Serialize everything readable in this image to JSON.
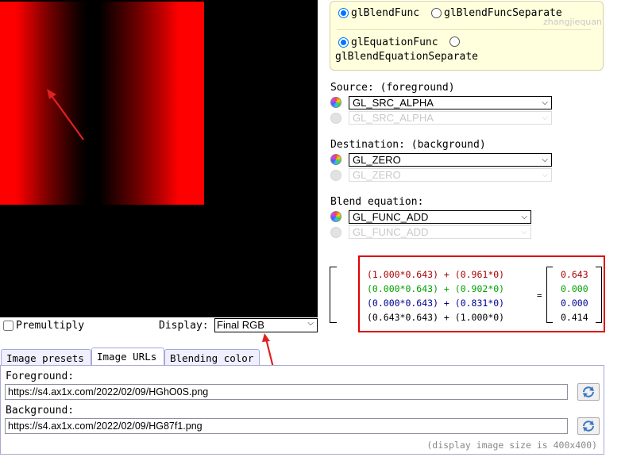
{
  "display": {
    "premultiply_label": "Premultiply",
    "premultiply_checked": false,
    "display_label": "Display:",
    "display_value": "Final RGB"
  },
  "tabs": [
    "Image presets",
    "Image URLs",
    "Blending color"
  ],
  "active_tab": "Image URLs",
  "urls": {
    "foreground_label": "Foreground:",
    "foreground_value": "https://s4.ax1x.com/2022/02/09/HGhO0S.png",
    "background_label": "Background:",
    "background_value": "https://s4.ax1x.com/2022/02/09/HG87f1.png",
    "size_note": "(display image size is 400x400)"
  },
  "blend_func": {
    "option1": "glBlendFunc",
    "option2": "glBlendFuncSeparate",
    "option3": "glEquationFunc",
    "option4": "glBlendEquationSeparate",
    "selected_func": "glBlendFunc",
    "selected_equation": "glEquationFunc"
  },
  "watermark": "zhangjiequan",
  "source": {
    "label": "Source: (foreground)",
    "value": "GL_SRC_ALPHA",
    "disabled_value": "GL_SRC_ALPHA"
  },
  "destination": {
    "label": "Destination: (background)",
    "value": "GL_ZERO",
    "disabled_value": "GL_ZERO"
  },
  "equation": {
    "label": "Blend equation:",
    "value": "GL_FUNC_ADD",
    "disabled_value": "GL_FUNC_ADD"
  },
  "formula": {
    "lines": [
      "(1.000*0.643) + (0.961*0)",
      "(0.000*0.643) + (0.902*0)",
      "(0.000*0.643) + (0.831*0)",
      "(0.643*0.643) + (1.000*0)"
    ],
    "equals": "=",
    "results": [
      "0.643",
      "0.000",
      "0.000",
      "0.414"
    ],
    "colors": [
      "#aa0000",
      "#00a000",
      "#000090",
      "#000000"
    ]
  },
  "colors": {
    "highlight_box": "#e00000",
    "arrow": "#e02020",
    "panel_border": "#a7a7d6",
    "tab_bg": "#eef0ff",
    "func_box_bg": "#ffffdd"
  }
}
